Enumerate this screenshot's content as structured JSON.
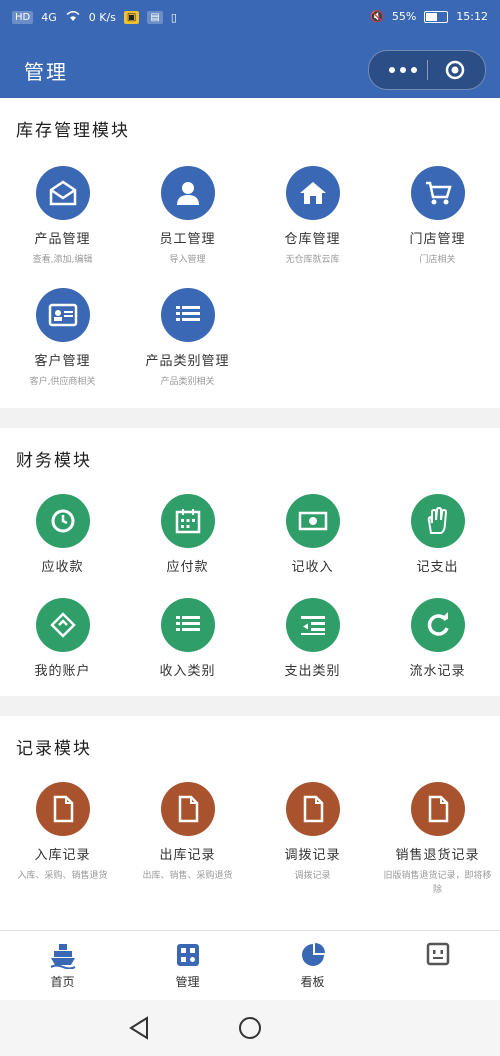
{
  "status_bar": {
    "left_chips": [
      "HD",
      "4G",
      "0 K/s"
    ],
    "battery_pct": "55%",
    "time": "15:12"
  },
  "header": {
    "title": "管理"
  },
  "sections": [
    {
      "title": "库存管理模块",
      "items": [
        {
          "label": "产品管理",
          "sub": "查看,添加,编辑",
          "icon": "envelope-icon",
          "color": "#3a68b4"
        },
        {
          "label": "员工管理",
          "sub": "导入管理",
          "icon": "user-icon",
          "color": "#3a68b4"
        },
        {
          "label": "仓库管理",
          "sub": "无仓库就云库",
          "icon": "home-icon",
          "color": "#3a68b4"
        },
        {
          "label": "门店管理",
          "sub": "门店相关",
          "icon": "cart-icon",
          "color": "#3a68b4"
        },
        {
          "label": "客户管理",
          "sub": "客户,供应商相关",
          "icon": "contact-card-icon",
          "color": "#3a68b4"
        },
        {
          "label": "产品类别管理",
          "sub": "产品类别相关",
          "icon": "list-icon",
          "color": "#3a68b4"
        }
      ]
    },
    {
      "title": "财务模块",
      "items": [
        {
          "label": "应收款",
          "icon": "clock-icon",
          "color": "#2f9e69"
        },
        {
          "label": "应付款",
          "icon": "calendar-icon",
          "color": "#2f9e69"
        },
        {
          "label": "记收入",
          "icon": "money-icon",
          "color": "#2f9e69"
        },
        {
          "label": "记支出",
          "icon": "hand-icon",
          "color": "#2f9e69"
        },
        {
          "label": "我的账户",
          "icon": "swap-icon",
          "color": "#2f9e69"
        },
        {
          "label": "收入类别",
          "icon": "list-icon",
          "color": "#2f9e69"
        },
        {
          "label": "支出类别",
          "icon": "indent-list-icon",
          "color": "#2f9e69"
        },
        {
          "label": "流水记录",
          "icon": "refresh-icon",
          "color": "#2f9e69"
        }
      ]
    },
    {
      "title": "记录模块",
      "items": [
        {
          "label": "入库记录",
          "sub": "入库、采购、销售退货",
          "icon": "document-icon",
          "color": "#a8532e"
        },
        {
          "label": "出库记录",
          "sub": "出库、销售、采购退货",
          "icon": "document-icon",
          "color": "#a8532e"
        },
        {
          "label": "调拨记录",
          "sub": "调拨记录",
          "icon": "document-icon",
          "color": "#a8532e"
        },
        {
          "label": "销售退货记录",
          "sub": "旧版销售退货记录，即将移除",
          "icon": "document-icon",
          "color": "#a8532e"
        }
      ]
    }
  ],
  "tabs": [
    {
      "label": "首页",
      "icon": "ship-icon"
    },
    {
      "label": "管理",
      "icon": "grid-icon"
    },
    {
      "label": "看板",
      "icon": "pie-chart-icon"
    },
    {
      "label": "",
      "icon": "face-icon"
    }
  ]
}
